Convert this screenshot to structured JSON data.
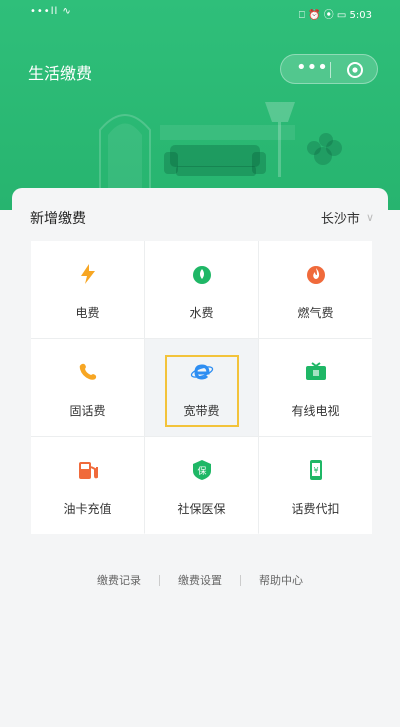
{
  "status": {
    "left": "•••ll ∿",
    "right": "⎕ ⏰ ⦿ ▭ 5:03",
    "time": "5:03"
  },
  "header": {
    "title": "生活缴费"
  },
  "card": {
    "title": "新增缴费",
    "city": "长沙市"
  },
  "items": [
    {
      "label": "电费",
      "icon": "lightning-icon",
      "color": "#f7a623"
    },
    {
      "label": "水费",
      "icon": "water-drop-icon",
      "color": "#1fb766"
    },
    {
      "label": "燃气费",
      "icon": "flame-icon",
      "color": "#f06a3b"
    },
    {
      "label": "固话费",
      "icon": "phone-icon",
      "color": "#f7a623"
    },
    {
      "label": "宽带费",
      "icon": "broadband-e-icon",
      "color": "#2e8ef2"
    },
    {
      "label": "有线电视",
      "icon": "tv-icon",
      "color": "#1fb766"
    },
    {
      "label": "油卡充值",
      "icon": "fuel-pump-icon",
      "color": "#f06a3b"
    },
    {
      "label": "社保医保",
      "icon": "shield-bao-icon",
      "color": "#1fb766"
    },
    {
      "label": "话费代扣",
      "icon": "mobile-yen-icon",
      "color": "#1fb766"
    }
  ],
  "links": [
    "缴费记录",
    "缴费设置",
    "帮助中心"
  ]
}
